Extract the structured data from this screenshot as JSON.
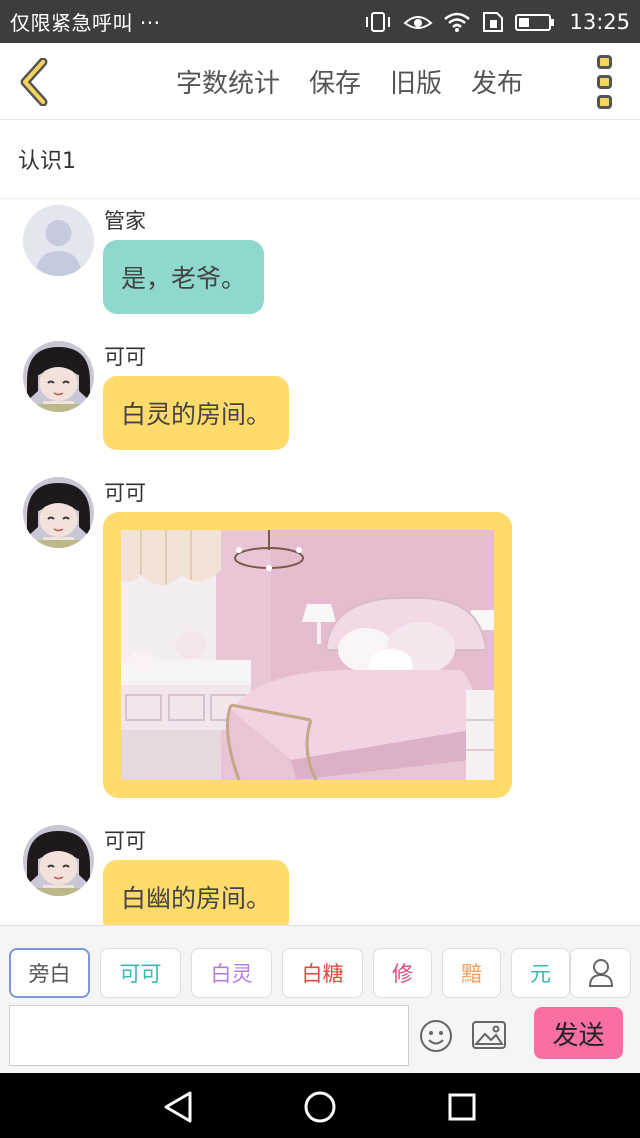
{
  "status_bar": {
    "carrier": "仅限紧急呼叫 ···",
    "time": "13:25",
    "icons": [
      "vibrate-icon",
      "eye-icon",
      "wifi-icon",
      "sim-icon",
      "battery-icon"
    ]
  },
  "toolbar": {
    "back_icon": "chevron-left-icon",
    "items": [
      "字数统计",
      "保存",
      "旧版",
      "发布"
    ],
    "more_icon": "more-vertical-icon",
    "accent_color": "#f5d55b"
  },
  "chapter": {
    "title": "认识1"
  },
  "messages": [
    {
      "sender": "管家",
      "text": "是，老爷。",
      "avatar": "default-user-avatar",
      "bubble_color": "#8fd8cd"
    },
    {
      "sender": "可可",
      "text": "白灵的房间。",
      "avatar": "anime-girl-avatar",
      "bubble_color": "#fedb6a"
    },
    {
      "sender": "可可",
      "image": "pink-bedroom-photo",
      "avatar": "anime-girl-avatar",
      "bubble_color": "#fedb6a"
    },
    {
      "sender": "可可",
      "text": "白幽的房间。",
      "avatar": "anime-girl-avatar",
      "bubble_color": "#fedb6a"
    }
  ],
  "roles": [
    {
      "label": "旁白",
      "color": "#555555",
      "active": true
    },
    {
      "label": "可可",
      "color": "#3cb8b0"
    },
    {
      "label": "白灵",
      "color": "#b27be0"
    },
    {
      "label": "白糖",
      "color": "#e04a3c"
    },
    {
      "label": "修",
      "color": "#e0457e"
    },
    {
      "label": "黯",
      "color": "#f0a05a"
    },
    {
      "label": "元",
      "color": "#3cb8b0"
    }
  ],
  "input": {
    "placeholder": "",
    "value": ""
  },
  "send_button": {
    "label": "发送",
    "color": "#fa6fa3"
  },
  "nav_icons": [
    "back-triangle-icon",
    "home-circle-icon",
    "recents-square-icon"
  ]
}
